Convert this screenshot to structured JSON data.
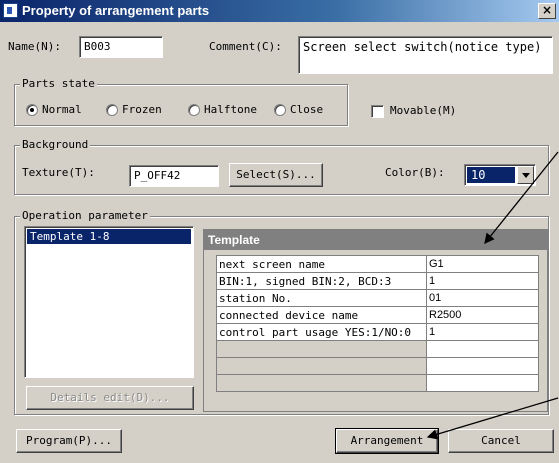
{
  "window": {
    "title": "Property of arrangement parts",
    "close_label": "×"
  },
  "name": {
    "label": "Name(N):",
    "value": "B003"
  },
  "comment": {
    "label": "Comment(C):",
    "value": "Screen select switch(notice type)"
  },
  "parts_state": {
    "legend": "Parts state",
    "options": [
      {
        "label": "Normal",
        "selected": true
      },
      {
        "label": "Frozen",
        "selected": false
      },
      {
        "label": "Halftone",
        "selected": false
      },
      {
        "label": "Close",
        "selected": false
      }
    ],
    "movable_label": "Movable(M)",
    "movable_checked": false
  },
  "background": {
    "legend": "Background",
    "texture_label": "Texture(T):",
    "texture_value": "P_OFF42",
    "select_button": "Select(S)...",
    "color_label": "Color(B):",
    "color_value": "10",
    "color_selected_bg": "#0a246a"
  },
  "operation": {
    "legend": "Operation parameter",
    "list_items": [
      "Template 1-8"
    ],
    "details_button": "Details edit(D)..."
  },
  "template": {
    "header": "Template",
    "rows": [
      {
        "key": "next screen name",
        "value": "G1"
      },
      {
        "key": "BIN:1, signed BIN:2, BCD:3",
        "value": "1"
      },
      {
        "key": "station No.",
        "value": "01"
      },
      {
        "key": "connected device name",
        "value": "R2500"
      },
      {
        "key": "control part usage YES:1/NO:0",
        "value": "1"
      },
      {
        "key": "",
        "value": ""
      },
      {
        "key": "",
        "value": ""
      },
      {
        "key": "",
        "value": ""
      }
    ]
  },
  "footer": {
    "program_button": "Program(P)...",
    "arrangement_button": "Arrangement",
    "cancel_button": "Cancel"
  },
  "colors": {
    "titlebar": "#0a246a",
    "face": "#d4d0c8",
    "selection": "#0a246a"
  }
}
